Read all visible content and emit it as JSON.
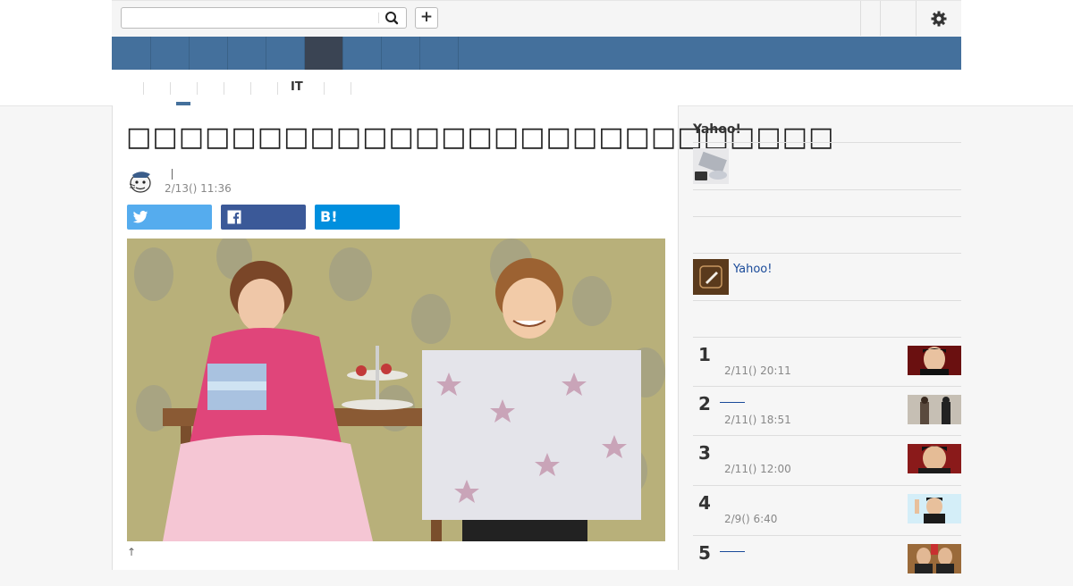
{
  "header": {
    "search_placeholder": "",
    "search_value": "",
    "search_icon": "search-icon",
    "add_label": "+",
    "settings_icon": "gear-icon"
  },
  "subnav": {
    "it_label": "IT"
  },
  "article": {
    "title": "□□□□□□□□□□□□□□□□□□□□□□□□□□□",
    "author_separator": "|",
    "date": "2/13() 11:36",
    "share": {
      "twitter_icon": "twitter-icon",
      "facebook_icon": "facebook-icon",
      "hatena_label": "B!"
    },
    "caption": "↑"
  },
  "sidebar": {
    "title": "Yahoo!",
    "link_label": "Yahoo!",
    "ranking": [
      {
        "rank": "1",
        "time": "2/11() 20:11"
      },
      {
        "rank": "2",
        "time": "2/11() 18:51"
      },
      {
        "rank": "3",
        "time": "2/11() 12:00"
      },
      {
        "rank": "4",
        "time": "2/9() 6:40"
      },
      {
        "rank": "5",
        "time": ""
      }
    ]
  },
  "colors": {
    "nav_bg": "#44709c",
    "nav_active": "#3a4453",
    "twitter": "#55acee",
    "facebook": "#3b5998",
    "hatena": "#008fde",
    "link": "#1a4a99"
  }
}
